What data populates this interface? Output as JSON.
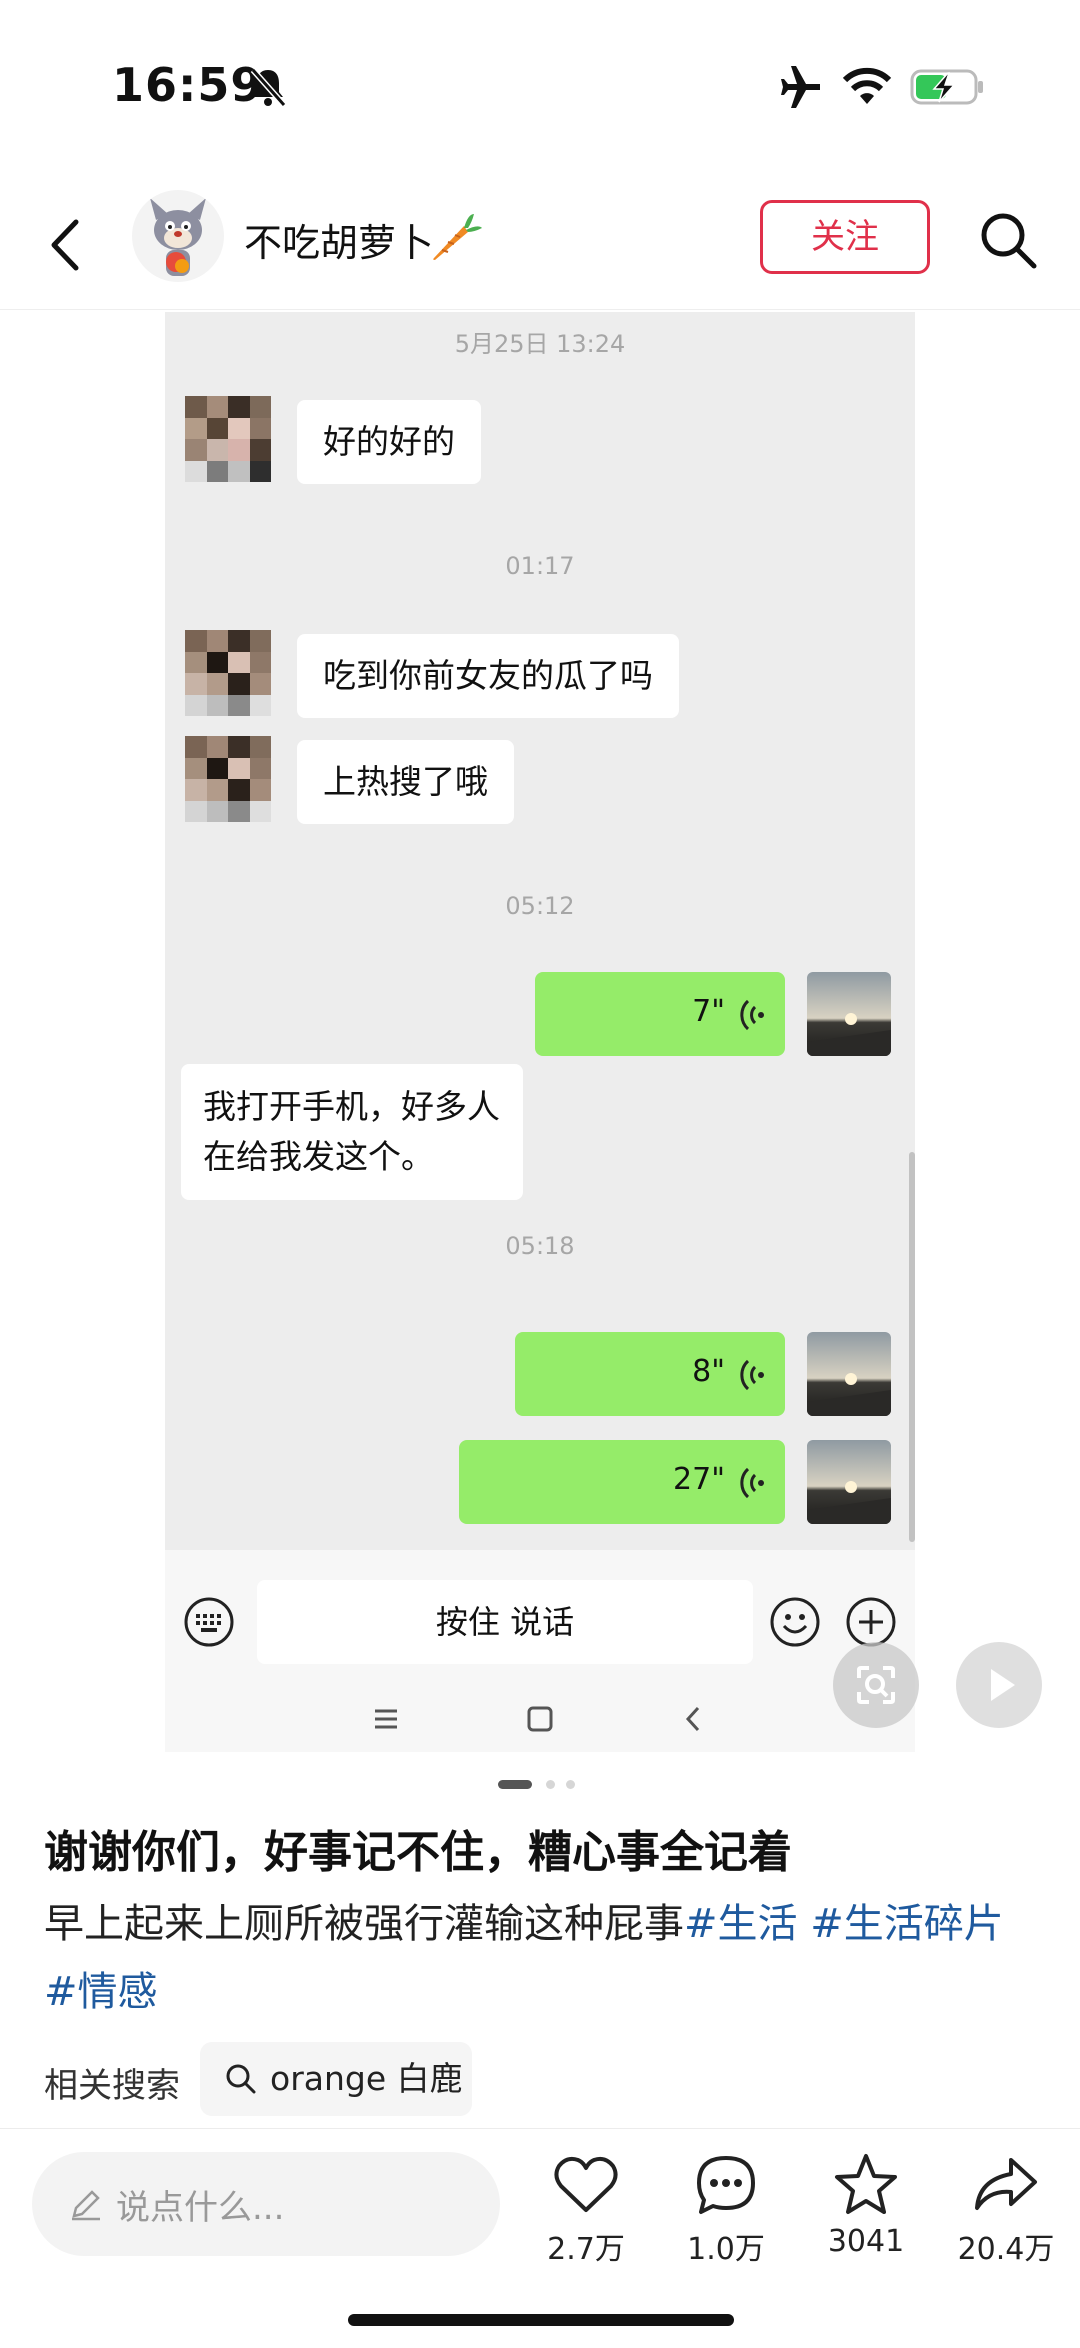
{
  "status_bar": {
    "time": "16:59"
  },
  "header": {
    "username": "不吃胡萝卜",
    "follow_label": "关注"
  },
  "chat": {
    "timestamps": [
      "5月25日 13:24",
      "01:17",
      "05:12",
      "05:18"
    ],
    "incoming": [
      "好的好的",
      "吃到你前女友的瓜了吗",
      "上热搜了哦",
      "我打开手机，好多人在给我发这个。"
    ],
    "voice": [
      "7\"",
      "8\"",
      "27\""
    ],
    "input_label": "按住 说话"
  },
  "post": {
    "title": "谢谢你们，好事记不住，糟心事全记着",
    "body": "早上起来上厕所被强行灌输这种屁事",
    "tags": [
      "#生活",
      "#生活碎片",
      "#情感"
    ],
    "related_label": "相关搜索",
    "related_query": "orange 白鹿"
  },
  "bottom": {
    "comment_placeholder": "说点什么...",
    "likes": "2.7万",
    "comments": "1.0万",
    "favorites": "3041",
    "shares": "20.4万"
  },
  "colors": {
    "accent": "#e0304a",
    "tag": "#1f5a9e",
    "bubble_out": "#95ec69",
    "chat_bg": "#ededed"
  }
}
